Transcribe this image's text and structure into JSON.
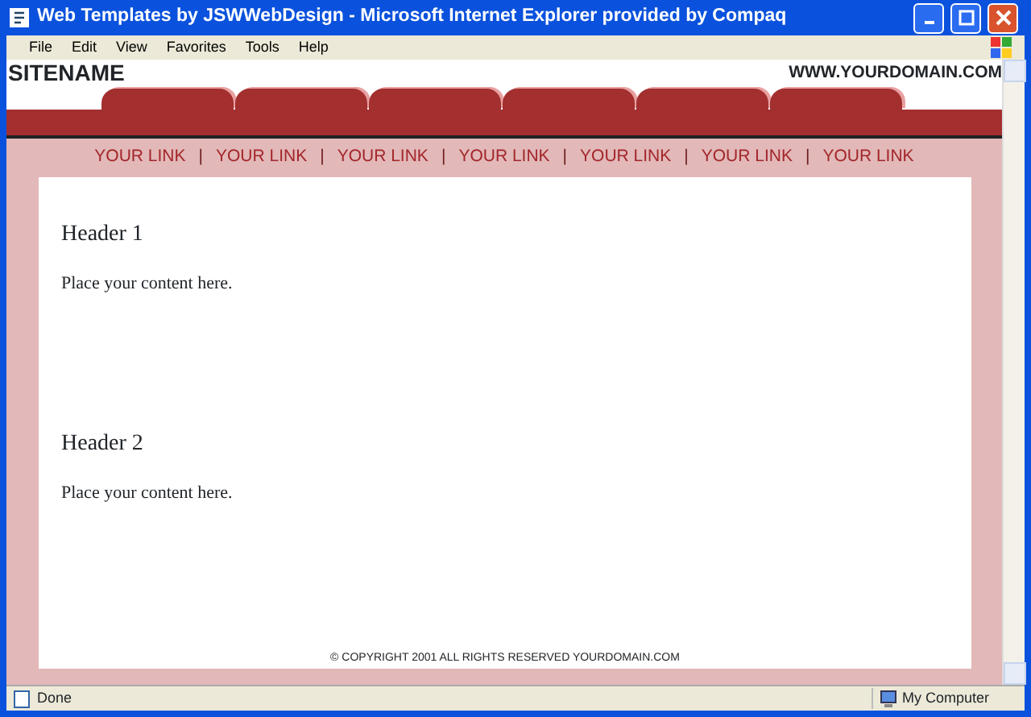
{
  "window": {
    "title": "Web Templates by JSWWebDesign - Microsoft Internet Explorer provided by Compaq"
  },
  "menu": [
    "File",
    "Edit",
    "View",
    "Favorites",
    "Tools",
    "Help"
  ],
  "site": {
    "name": "SITENAME",
    "domain": "WWW.YOURDOMAIN.COM"
  },
  "tabs": [
    {
      "kind": "tab"
    },
    {
      "kind": "tab"
    },
    {
      "kind": "tab"
    },
    {
      "kind": "tab"
    },
    {
      "kind": "tab"
    },
    {
      "kind": "tab"
    }
  ],
  "nav": [
    {
      "kind": "link",
      "text": "YOUR LINK"
    },
    {
      "kind": "separator",
      "text": "|"
    },
    {
      "kind": "link",
      "text": "YOUR LINK"
    },
    {
      "kind": "separator",
      "text": "|"
    },
    {
      "kind": "link",
      "text": "YOUR LINK"
    },
    {
      "kind": "separator",
      "text": "|"
    },
    {
      "kind": "link",
      "text": "YOUR LINK"
    },
    {
      "kind": "separator",
      "text": "|"
    },
    {
      "kind": "link",
      "text": "YOUR LINK"
    },
    {
      "kind": "separator",
      "text": "|"
    },
    {
      "kind": "link",
      "text": "YOUR LINK"
    },
    {
      "kind": "separator",
      "text": "|"
    },
    {
      "kind": "link",
      "text": "YOUR LINK"
    }
  ],
  "sections": [
    {
      "header": "Header 1",
      "body": "Place your content here."
    },
    {
      "header": "Header 2",
      "body": "Place your content here."
    }
  ],
  "copyright": "© COPYRIGHT 2001 ALL RIGHTS RESERVED YOURDOMAIN.COM",
  "status_bar": {
    "text": "Done",
    "zone": "My Computer"
  }
}
